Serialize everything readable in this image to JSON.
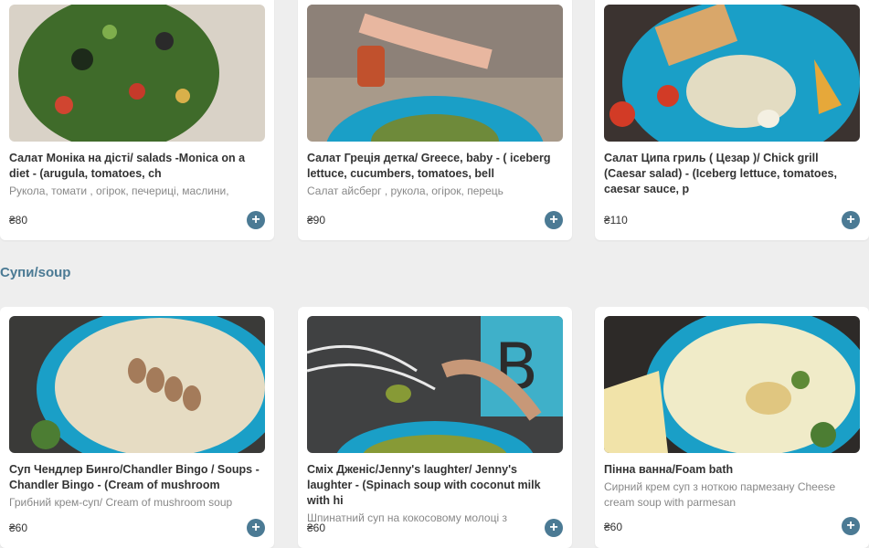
{
  "sections": [
    {
      "title": "",
      "items": [
        {
          "title": "Салат Моніка на дісті/ salads -Monica on a diet - (arugula, tomatoes, ch",
          "desc": "Рукола, томати , огірок, печериці, маслини,",
          "price": "₴80"
        },
        {
          "title": "Салат Греція детка/ Greece, baby - ( iceberg lettuce, cucumbers, tomatoes, bell",
          "desc": "Салат айсберг , рукола, огірок, перець",
          "price": "₴90"
        },
        {
          "title": "Салат Ципа гриль ( Цезар )/ Chick grill (Caesar salad) - (Iceberg lettuce, tomatoes, caesar sauce, p",
          "desc": "",
          "price": "₴110"
        }
      ]
    },
    {
      "title": "Супи/soup",
      "items": [
        {
          "title": "Суп Чендлер Бинго/Chandler Bingo / Soups - Chandler Bingo - (Cream of mushroom",
          "desc": "Грибний крем-суп/ Cream of mushroom soup",
          "price": "₴60"
        },
        {
          "title": "Сміх Дженіс/Jenny's laughter/ Jenny's laughter - (Spinach soup with coconut milk with hi",
          "desc": "Шпинатний суп на кокосовому молоці з",
          "price": "₴60"
        },
        {
          "title": "Пінна ванна/Foam bath",
          "desc": "Сирний крем суп з ноткою пармезану Cheese cream soup with parmesan",
          "price": "₴60"
        }
      ]
    }
  ],
  "add_label": "+",
  "colors": {
    "accent": "#4b7a94",
    "background": "#eeeeee",
    "card": "#ffffff"
  },
  "icons": {
    "add": "plus-icon"
  }
}
